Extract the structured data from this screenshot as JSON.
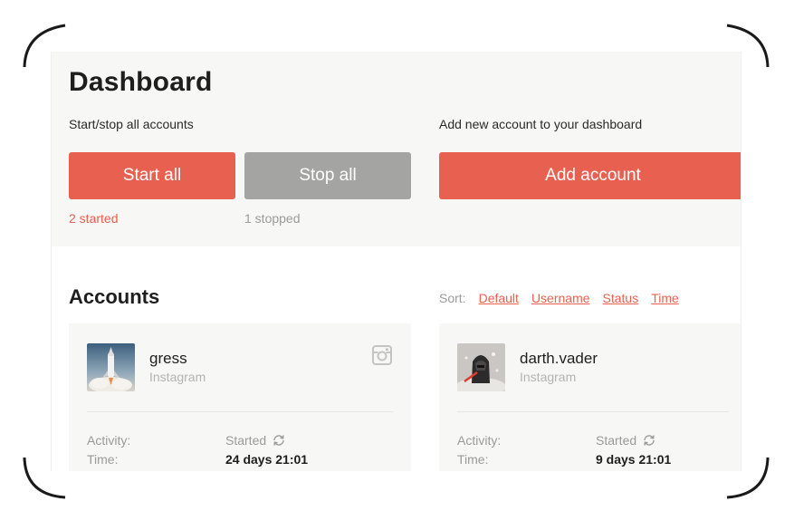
{
  "header": {
    "title": "Dashboard",
    "start_stop_text": "Start/stop all accounts",
    "add_text": "Add new account to your dashboard"
  },
  "actions": {
    "start_all_label": "Start all",
    "stop_all_label": "Stop all",
    "add_account_label": "Add account",
    "started_count": "2 started",
    "stopped_count": "1 stopped"
  },
  "accounts": {
    "title": "Accounts",
    "sort_label": "Sort:",
    "sort_options": [
      "Default",
      "Username",
      "Status",
      "Time"
    ],
    "items": [
      {
        "username": "gress",
        "network": "Instagram",
        "activity_label": "Activity:",
        "activity_value": "Started",
        "time_label": "Time:",
        "time_value": "24 days 21:01"
      },
      {
        "username": "darth.vader",
        "network": "Instagram",
        "activity_label": "Activity:",
        "activity_value": "Started",
        "time_label": "Time:",
        "time_value": "9 days 21:01"
      }
    ]
  },
  "colors": {
    "accent": "#e8604f",
    "stopped": "#a4a4a2",
    "panel": "#f7f7f5"
  },
  "icons": [
    "instagram-icon",
    "refresh-icon"
  ]
}
